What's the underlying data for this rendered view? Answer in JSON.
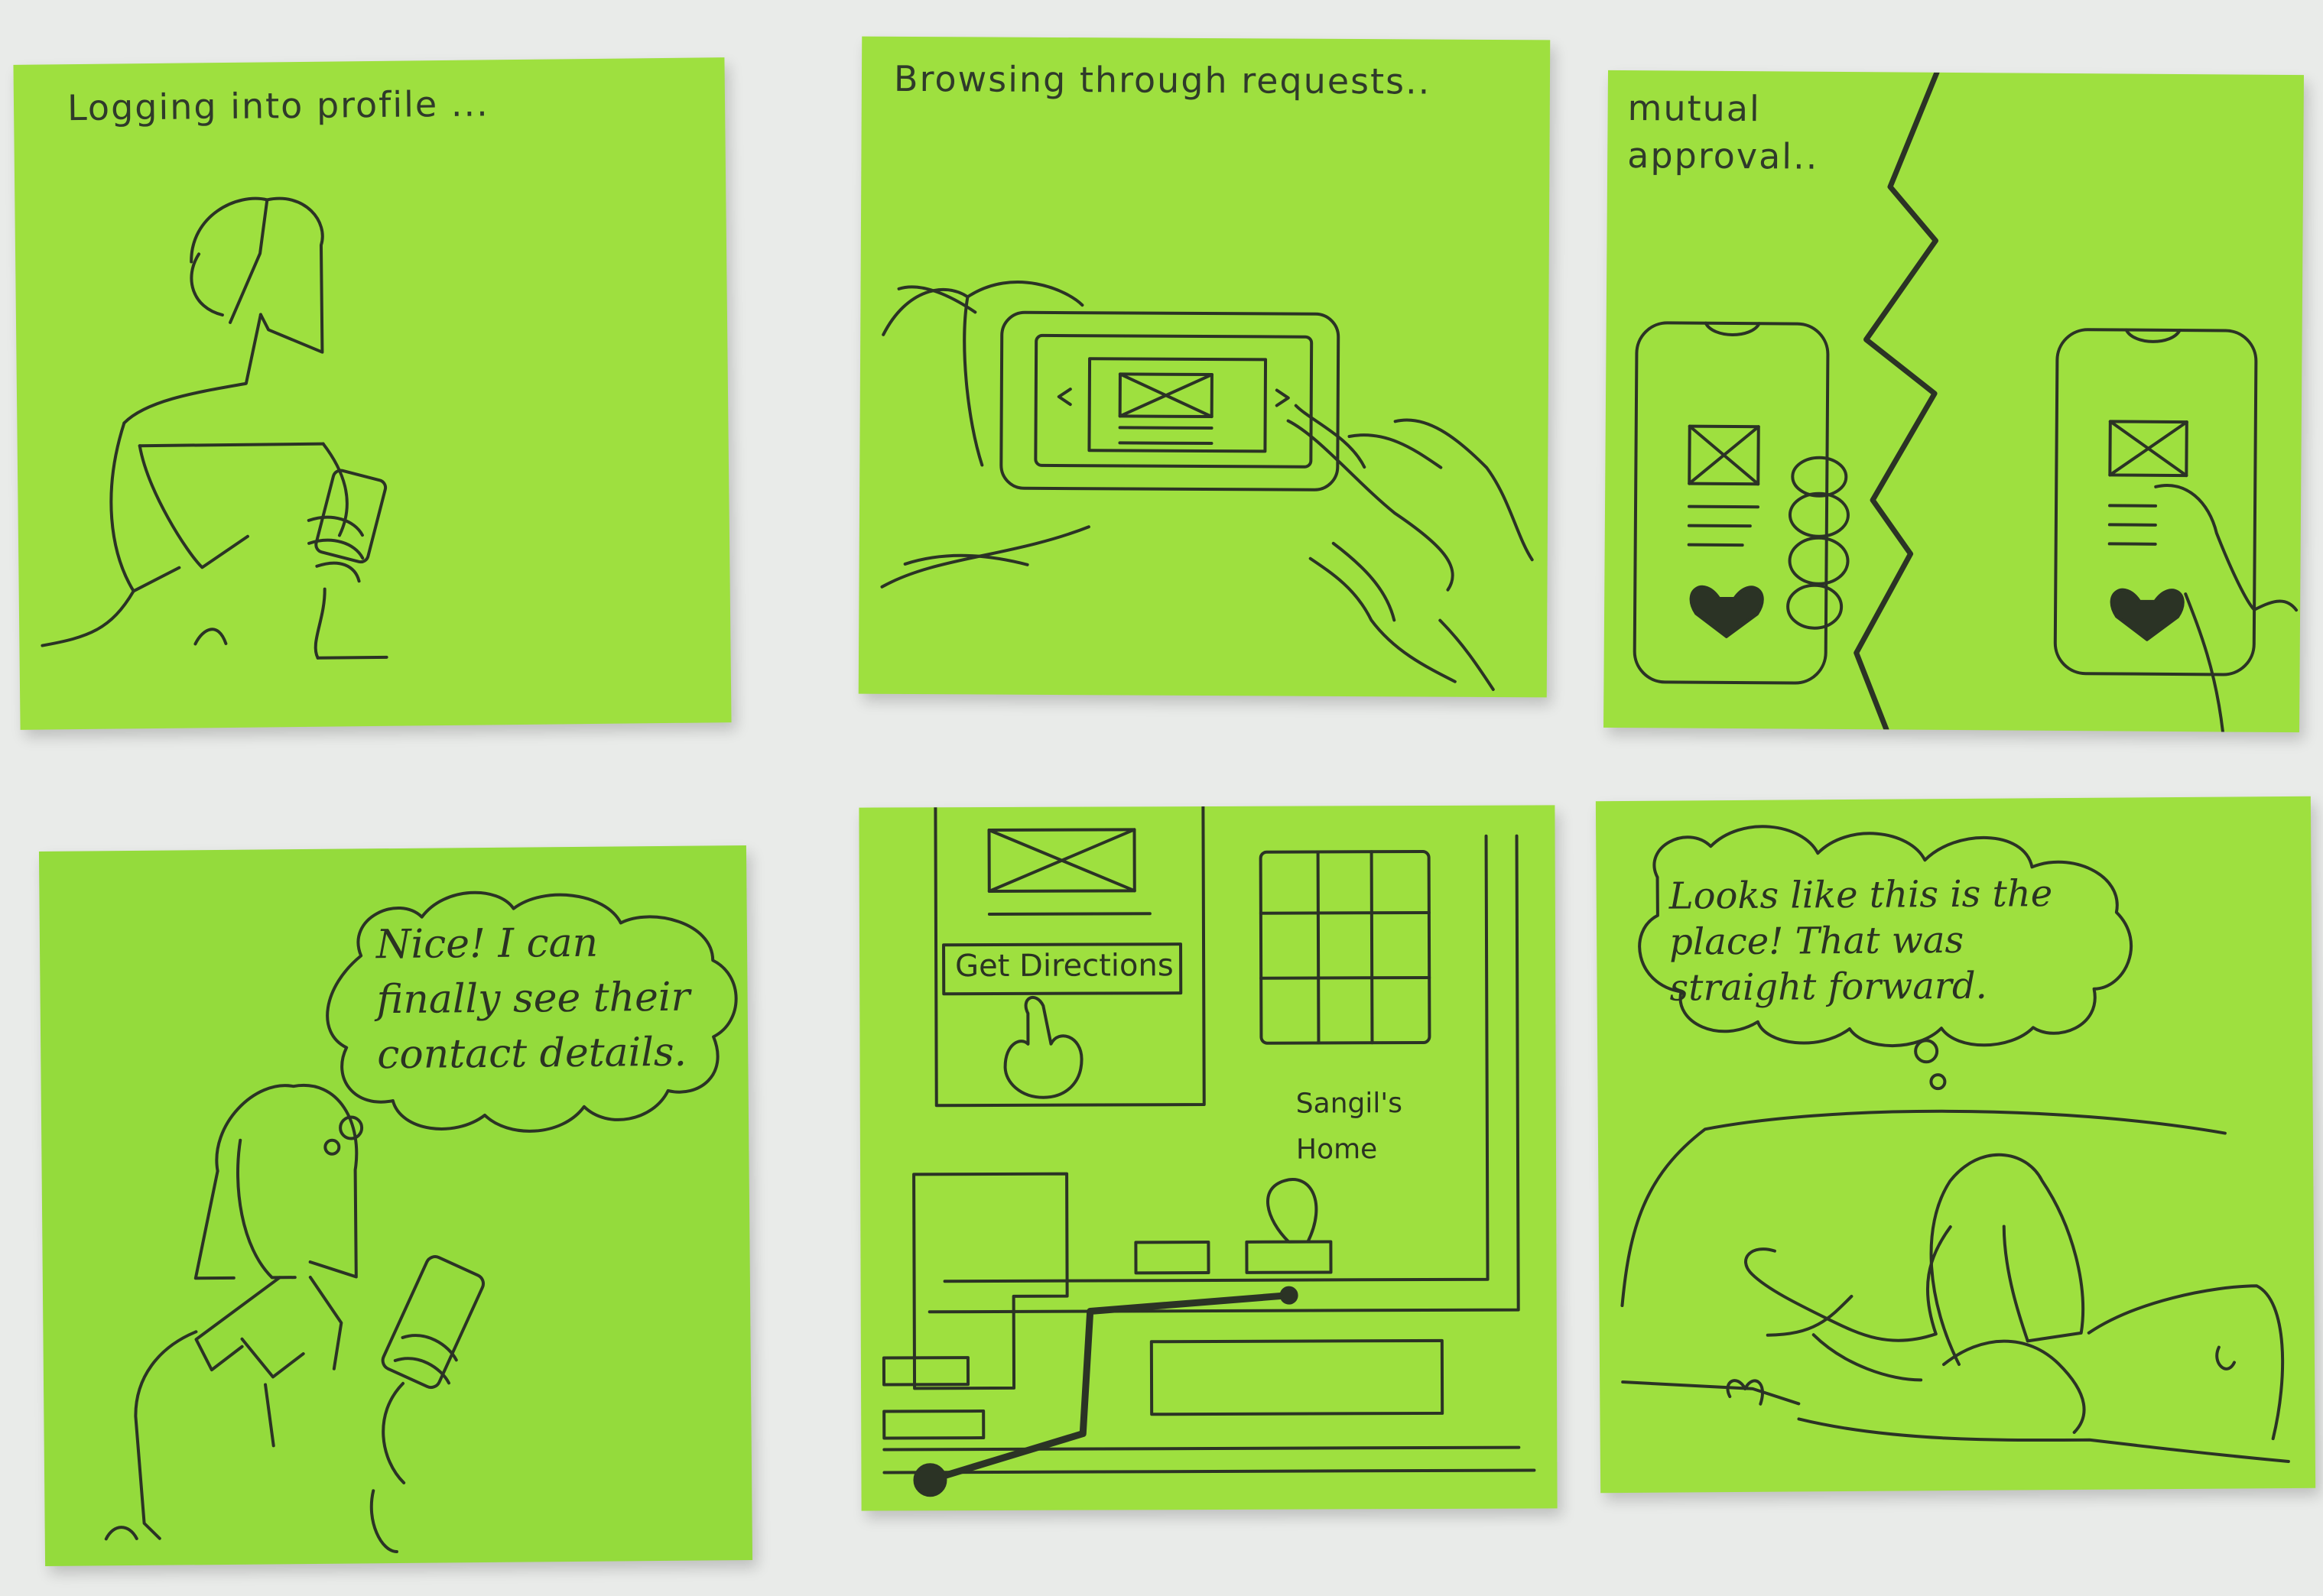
{
  "colors": {
    "note_green": "#9ee03f",
    "note_green_alt": "#94db3c",
    "background": "#e9ebe9",
    "ink": "#2b3325"
  },
  "panels": [
    {
      "caption": "Logging into profile ..."
    },
    {
      "caption": "Browsing through requests.."
    },
    {
      "caption": "mutual\napproval.."
    },
    {
      "bubble": "Nice! I can finally see their contact details."
    },
    {
      "button_label": "Get Directions",
      "map_label": "Sangil's\nHome"
    },
    {
      "bubble": "Looks like this is the place! That was straight forward."
    }
  ]
}
